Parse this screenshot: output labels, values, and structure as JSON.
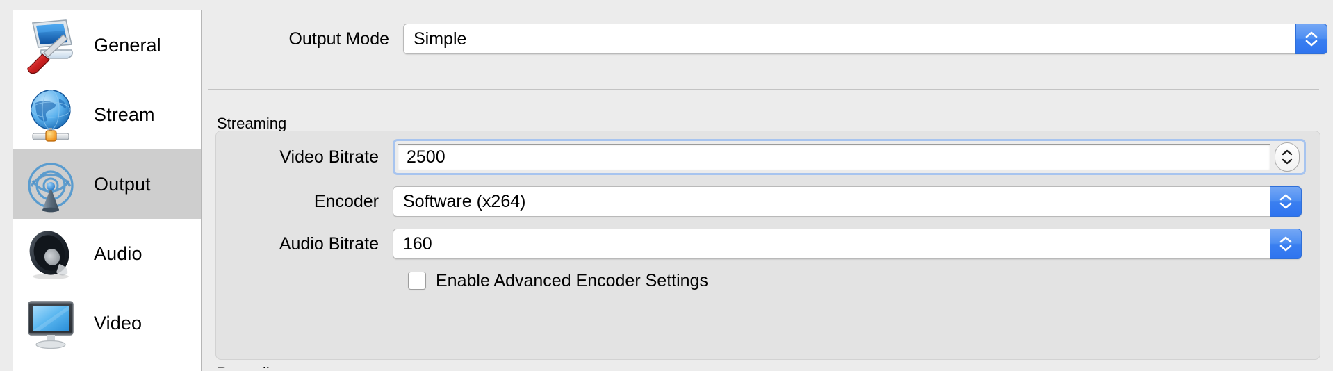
{
  "sidebar": {
    "items": [
      {
        "label": "General",
        "icon": "monitor-screwdriver-icon",
        "selected": false
      },
      {
        "label": "Stream",
        "icon": "globe-network-icon",
        "selected": false
      },
      {
        "label": "Output",
        "icon": "broadcast-antenna-icon",
        "selected": true
      },
      {
        "label": "Audio",
        "icon": "speaker-icon",
        "selected": false
      },
      {
        "label": "Video",
        "icon": "display-monitor-icon",
        "selected": false
      }
    ]
  },
  "main": {
    "output_mode": {
      "label": "Output Mode",
      "value": "Simple",
      "control": "combobox"
    },
    "streaming": {
      "group_label": "Streaming",
      "video_bitrate": {
        "label": "Video Bitrate",
        "value": "2500",
        "control": "spinbox",
        "focused": true
      },
      "encoder": {
        "label": "Encoder",
        "value": "Software (x264)",
        "control": "combobox"
      },
      "audio_bitrate": {
        "label": "Audio Bitrate",
        "value": "160",
        "control": "combobox"
      },
      "advanced_checkbox": {
        "label": "Enable Advanced Encoder Settings",
        "checked": false
      }
    },
    "next_group_label": "Recording"
  },
  "colors": {
    "window_bg": "#ececec",
    "sidebar_bg": "#ffffff",
    "sidebar_selected_bg": "#cecece",
    "groupbox_bg": "#e3e3e3",
    "accent_blue": "#3a7ff0",
    "focus_ring": "#a7c4ef",
    "text": "#000000"
  }
}
